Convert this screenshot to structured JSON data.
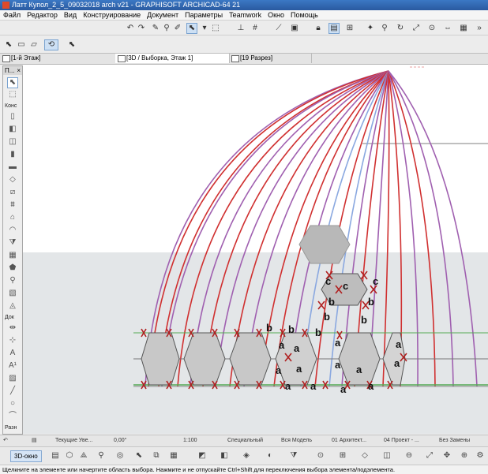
{
  "window": {
    "title": "Латт Купол_2_5_09032018 arch v21 - GRAPHISOFT ARCHICAD-64 21"
  },
  "menu": [
    "Файл",
    "Редактор",
    "Вид",
    "Конструирование",
    "Документ",
    "Параметры",
    "Teamwork",
    "Окно",
    "Помощь"
  ],
  "tabs": [
    {
      "label": "[1-й Этаж]"
    },
    {
      "label": "[3D / Выборка, Этаж 1]"
    },
    {
      "label": "[19 Разрез]"
    }
  ],
  "toolbox": {
    "title": "П...",
    "sections": {
      "design": "Конс",
      "document": "Док",
      "more": "Разн"
    }
  },
  "status": {
    "layer": "Текущие Уве...",
    "angle": "0,00°",
    "scale": "1:100",
    "layer_combo": "Специальный",
    "model_view": "Вся Модель",
    "pen_set": "01 Архитект...",
    "project": "04 Проект - ...",
    "override": "Без Замены"
  },
  "bottombar": {
    "view_3d": "3D-окно"
  },
  "hint": "Щелкните на элементе или начертите область выбора. Нажмите и не отпускайте Ctrl+Shift для переключения выбора элемента/подэлемента.",
  "annotations": [
    {
      "text": "c"
    },
    {
      "text": "c"
    },
    {
      "text": "c"
    },
    {
      "text": "b"
    },
    {
      "text": "b"
    },
    {
      "text": "b"
    },
    {
      "text": "b"
    },
    {
      "text": "b"
    },
    {
      "text": "b"
    },
    {
      "text": "b"
    },
    {
      "text": "a"
    },
    {
      "text": "a"
    },
    {
      "text": "a"
    },
    {
      "text": "a"
    },
    {
      "text": "a"
    },
    {
      "text": "a"
    },
    {
      "text": "a"
    },
    {
      "text": "a"
    },
    {
      "text": "a"
    },
    {
      "text": "a"
    },
    {
      "text": "a"
    },
    {
      "text": "a"
    },
    {
      "text": "a"
    }
  ]
}
